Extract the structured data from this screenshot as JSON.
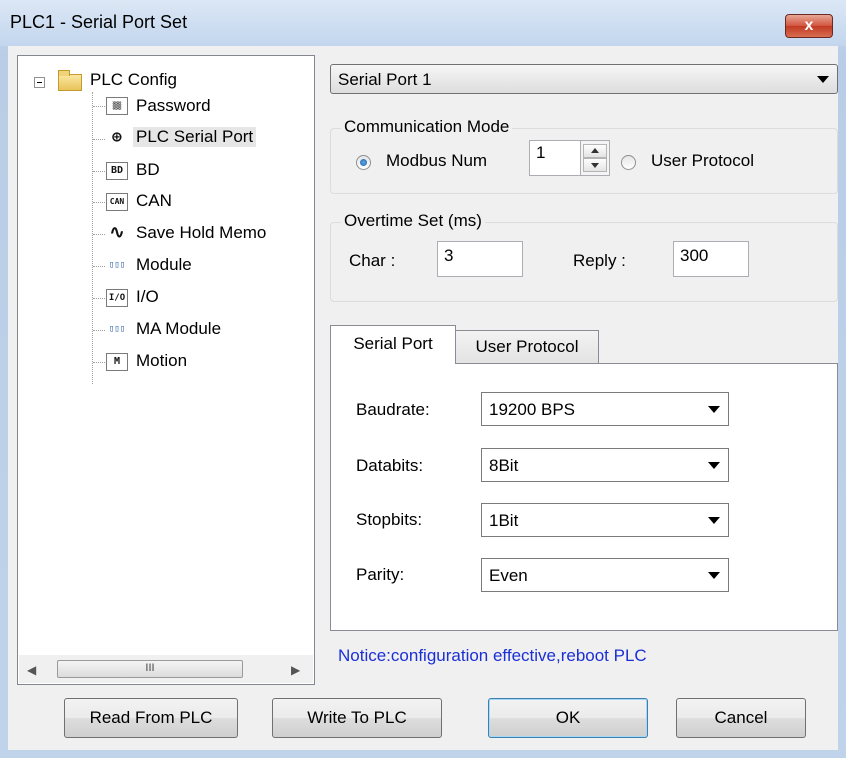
{
  "window": {
    "title": "PLC1 - Serial Port  Set",
    "close_glyph": "x"
  },
  "tree": {
    "root_label": "PLC Config",
    "items": [
      {
        "label": "Password",
        "icon": "password-icon",
        "glyph": "▒▒"
      },
      {
        "label": "PLC Serial Port",
        "icon": "serial-port-icon",
        "glyph": "⊕",
        "selected": true
      },
      {
        "label": "BD",
        "icon": "bd-icon",
        "glyph": "BD"
      },
      {
        "label": "CAN",
        "icon": "can-icon",
        "glyph": "CAN"
      },
      {
        "label": "Save Hold Memo",
        "icon": "waveform-icon",
        "glyph": "∿"
      },
      {
        "label": "Module",
        "icon": "module-icon",
        "glyph": "▯▯▯"
      },
      {
        "label": "I/O",
        "icon": "io-icon",
        "glyph": "I/O"
      },
      {
        "label": "MA Module",
        "icon": "ma-module-icon",
        "glyph": "▯▯▯"
      },
      {
        "label": "Motion",
        "icon": "motion-icon",
        "glyph": "M"
      }
    ],
    "scroll_left": "◀",
    "scroll_right": "▶",
    "scroll_thumb": "III"
  },
  "port_select": {
    "value": "Serial Port 1"
  },
  "communication": {
    "group_label": "Communication Mode",
    "modbus_label": "Modbus Num",
    "modbus_value": "1",
    "user_protocol_label": "User Protocol",
    "selected": "modbus"
  },
  "overtime": {
    "group_label": "Overtime Set (ms)",
    "char_label": "Char :",
    "char_value": "3",
    "reply_label": "Reply :",
    "reply_value": "300"
  },
  "tabs": [
    {
      "label": "Serial Port",
      "active": true
    },
    {
      "label": "User Protocol",
      "active": false
    }
  ],
  "serial": {
    "baudrate_label": "Baudrate:",
    "baudrate_value": "19200 BPS",
    "databits_label": "Databits:",
    "databits_value": "8Bit",
    "stopbits_label": "Stopbits:",
    "stopbits_value": "1Bit",
    "parity_label": "Parity:",
    "parity_value": "Even"
  },
  "notice": "Notice:configuration effective,reboot PLC",
  "buttons": {
    "read": "Read From PLC",
    "write": "Write To PLC",
    "ok": "OK",
    "cancel": "Cancel"
  },
  "colors": {
    "notice": "#1b2fd6",
    "close_button": "#c9462f",
    "title_bar": "#c6d8ee"
  }
}
